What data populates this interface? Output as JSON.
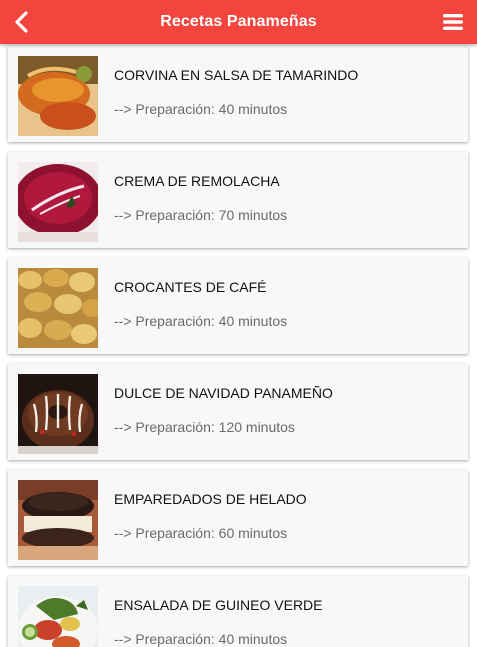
{
  "header": {
    "title": "Recetas Panameñas",
    "back_icon": "chevron-left-icon",
    "menu_icon": "hamburger-menu-icon",
    "bar_color": "#f2453d"
  },
  "recipes": [
    {
      "name": "CORVINA EN SALSA DE TAMARINDO",
      "prep": "--> Preparación: 40 minutos"
    },
    {
      "name": "CREMA DE REMOLACHA",
      "prep": "--> Preparación: 70 minutos"
    },
    {
      "name": "CROCANTES DE CAFÉ",
      "prep": "--> Preparación: 40 minutos"
    },
    {
      "name": "DULCE DE NAVIDAD PANAMEÑO",
      "prep": "--> Preparación: 120 minutos"
    },
    {
      "name": "EMPAREDADOS DE HELADO",
      "prep": "--> Preparación: 60 minutos"
    },
    {
      "name": "ENSALADA DE GUINEO VERDE",
      "prep": "--> Preparación: 40 minutos"
    }
  ]
}
